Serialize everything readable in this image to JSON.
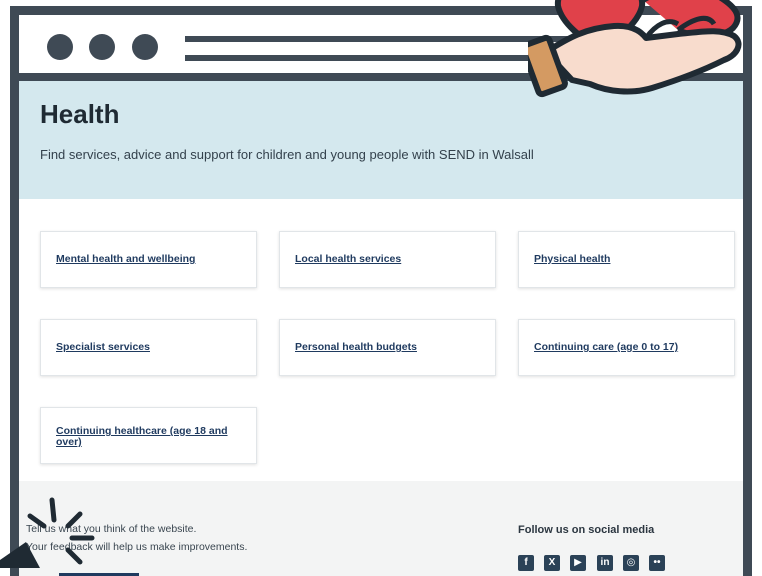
{
  "page": {
    "title": "Health",
    "subtitle": "Find services, advice and support for children and young people with SEND in Walsall"
  },
  "cards": [
    {
      "label": "Mental health and wellbeing"
    },
    {
      "label": "Local health services"
    },
    {
      "label": "Physical health"
    },
    {
      "label": "Specialist services"
    },
    {
      "label": "Personal health budgets"
    },
    {
      "label": "Continuing care (age 0 to 17)"
    },
    {
      "label": "Continuing healthcare (age 18 and over)"
    }
  ],
  "footer": {
    "feedback_line1": "Tell us what you think of the website.",
    "feedback_line2": "Your feedback will help us make improvements.",
    "follow_label": "Follow us on social media",
    "social_icons": [
      "facebook-icon",
      "x-icon",
      "youtube-icon",
      "linkedin-icon",
      "instagram-icon",
      "flickr-icon"
    ]
  },
  "colors": {
    "frame": "#3f4a55",
    "hero_bg": "#d4e8ee",
    "link": "#1f3a5f",
    "heart": "#e0414a",
    "hand": "#f8dccd",
    "sleeve": "#d49a62"
  }
}
